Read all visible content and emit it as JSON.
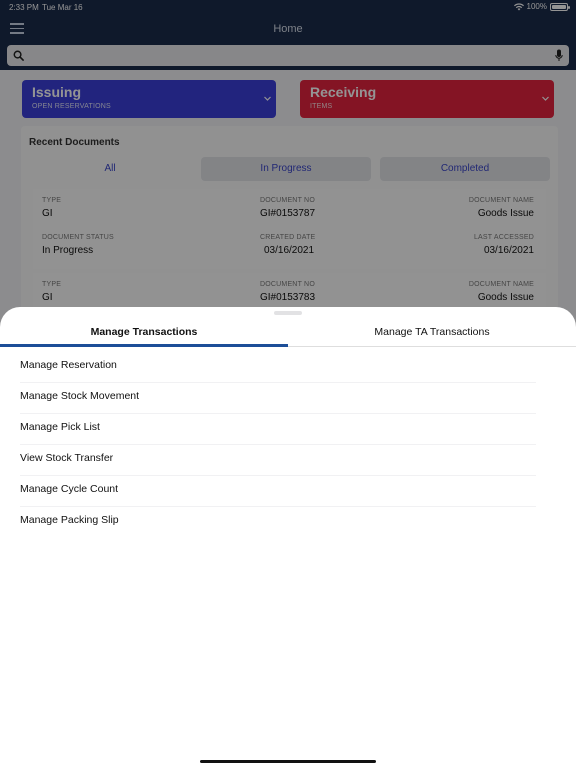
{
  "status_bar": {
    "time": "2:33 PM",
    "date": "Tue Mar 16",
    "battery": "100%",
    "battery_level": 1.0
  },
  "nav": {
    "title": "Home"
  },
  "search": {
    "value": "",
    "placeholder": ""
  },
  "tiles": [
    {
      "title": "Issuing",
      "subtitle": "OPEN RESERVATIONS",
      "color": "#3b3fd9"
    },
    {
      "title": "Receiving",
      "subtitle": "ITEMS",
      "color": "#e4243f"
    }
  ],
  "recent": {
    "title": "Recent Documents",
    "segments": [
      "All",
      "In Progress",
      "Completed"
    ],
    "documents": [
      {
        "type_label": "TYPE",
        "type": "GI",
        "doc_no_label": "DOCUMENT NO",
        "doc_no": "GI#0153787",
        "doc_name_label": "DOCUMENT NAME",
        "doc_name": "Goods Issue",
        "status_label": "DOCUMENT STATUS",
        "status": "In Progress",
        "created_label": "CREATED DATE",
        "created": "03/16/2021",
        "accessed_label": "LAST ACCESSED",
        "accessed": "03/16/2021"
      },
      {
        "type_label": "TYPE",
        "type": "GI",
        "doc_no_label": "DOCUMENT NO",
        "doc_no": "GI#0153783",
        "doc_name_label": "DOCUMENT NAME",
        "doc_name": "Goods Issue"
      }
    ]
  },
  "sheet": {
    "tabs": [
      "Manage Transactions",
      "Manage TA Transactions"
    ],
    "active_tab": 0,
    "accent_color": "#1d4e98",
    "items": [
      "Manage Reservation",
      "Manage Stock Movement",
      "Manage Pick List",
      "View Stock Transfer",
      "Manage Cycle Count",
      "Manage Packing Slip"
    ]
  }
}
